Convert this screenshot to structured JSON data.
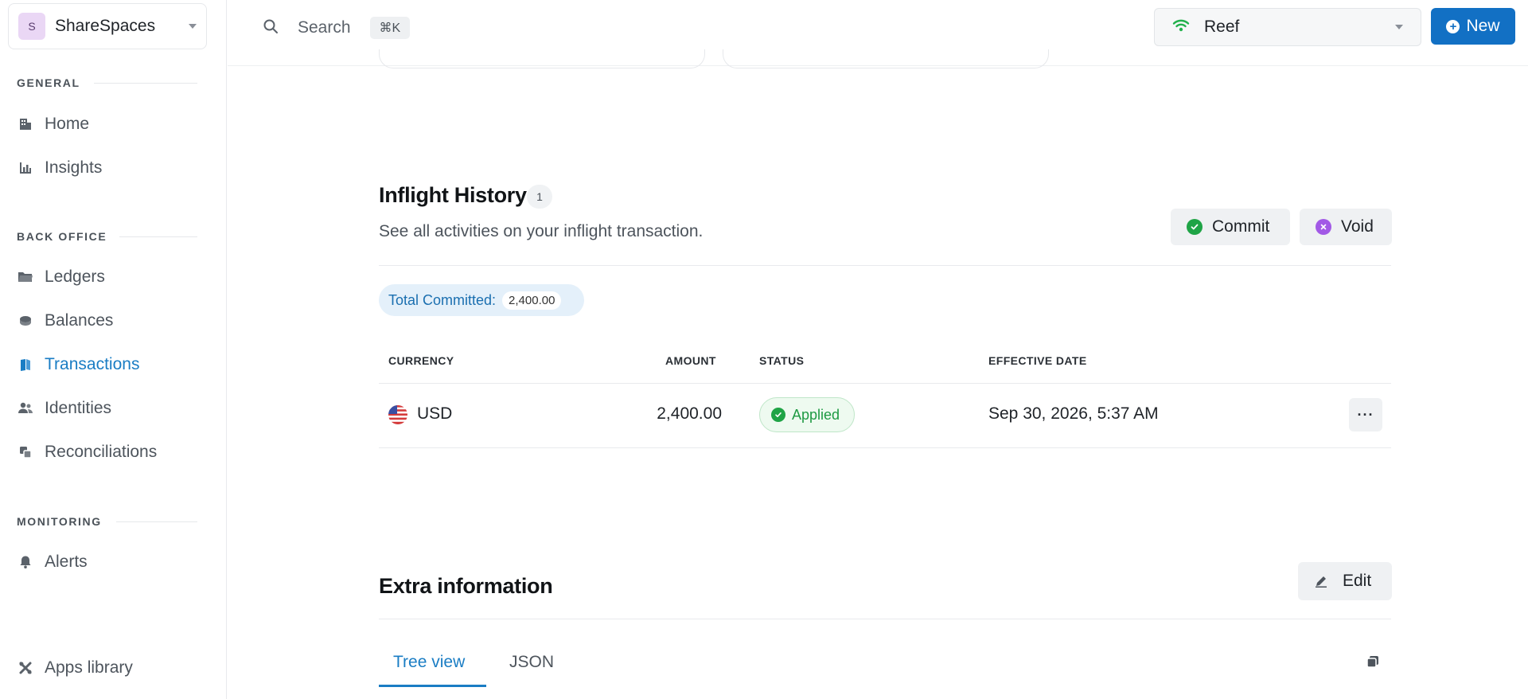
{
  "sidebar": {
    "workspace": {
      "initial": "S",
      "name": "ShareSpaces"
    },
    "sections": [
      {
        "title": "GENERAL"
      },
      {
        "title": "BACK OFFICE"
      },
      {
        "title": "MONITORING"
      }
    ],
    "items": {
      "home": "Home",
      "insights": "Insights",
      "ledgers": "Ledgers",
      "balances": "Balances",
      "transactions": "Transactions",
      "identities": "Identities",
      "reconciliations": "Reconciliations",
      "alerts": "Alerts",
      "apps_library": "Apps library"
    },
    "active_item": "transactions"
  },
  "topbar": {
    "search_label": "Search",
    "search_shortcut": "⌘K",
    "environment": "Reef",
    "new_button": "New"
  },
  "inflight": {
    "title": "Inflight History",
    "count": "1",
    "subtitle": "See all activities on your inflight transaction.",
    "commit_label": "Commit",
    "void_label": "Void",
    "total_label": "Total Committed:",
    "total_value": "2,400.00",
    "table": {
      "headers": {
        "currency": "CURRENCY",
        "amount": "AMOUNT",
        "status": "STATUS",
        "effective_date": "EFFECTIVE DATE"
      },
      "rows": [
        {
          "currency": "USD",
          "amount": "2,400.00",
          "status": "Applied",
          "effective_date": "Sep 30, 2026, 5:37 AM"
        }
      ]
    }
  },
  "extra": {
    "title": "Extra information",
    "edit_label": "Edit",
    "tabs": [
      "Tree view",
      "JSON"
    ],
    "active_tab": "Tree view"
  },
  "colors": {
    "accent": "#1a7dc4",
    "primary_button": "#1270c4",
    "success": "#1fa446",
    "void": "#a259e6"
  }
}
